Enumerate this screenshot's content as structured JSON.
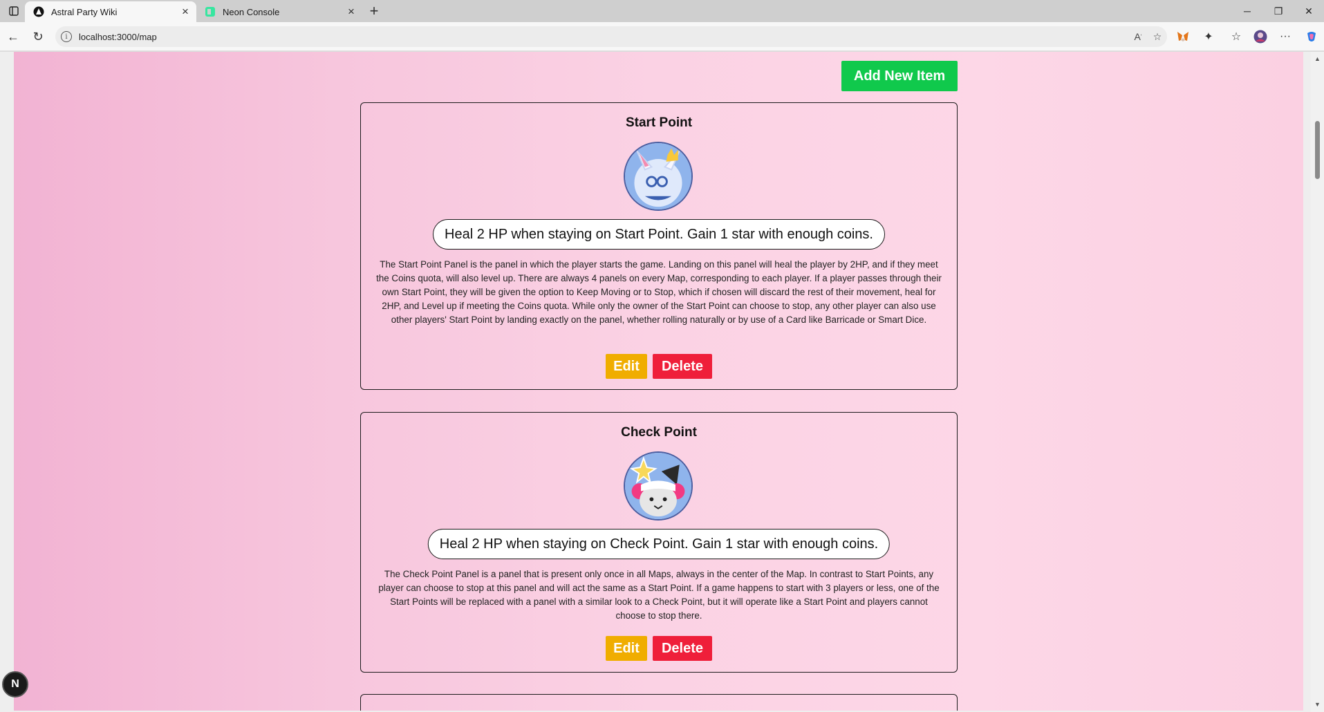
{
  "browser": {
    "tabs": [
      {
        "title": "Astral Party Wiki",
        "active": true,
        "icon": "app-logo-icon"
      },
      {
        "title": "Neon Console",
        "active": false,
        "icon": "neon-logo-icon"
      }
    ],
    "url": "localhost:3000/map"
  },
  "page": {
    "add_button_label": "Add New Item",
    "items": [
      {
        "name": "Start Point",
        "summary": "Heal 2 HP when staying on Start Point. Gain 1 star with enough coins.",
        "description": "The Start Point Panel is the panel in which the player starts the game. Landing on this panel will heal the player by 2HP, and if they meet the Coins quota, will also level up. There are always 4 panels on every Map, corresponding to each player. If a player passes through their own Start Point, they will be given the option to Keep Moving or to Stop, which if chosen will discard the rest of their movement, heal for 2HP, and Level up if meeting the Coins quota. While only the owner of the Start Point can choose to stop, any other player can also use other players' Start Point by landing exactly on the panel, whether rolling naturally or by use of a Card like Barricade or Smart Dice.",
        "edit_label": "Edit",
        "delete_label": "Delete"
      },
      {
        "name": "Check Point",
        "summary": "Heal 2 HP when staying on Check Point. Gain 1 star with enough coins.",
        "description": "The Check Point Panel is a panel that is present only once in all Maps, always in the center of the Map. In contrast to Start Points, any player can choose to stop at this panel and will act the same as a Start Point. If a game happens to start with 3 players or less, one of the Start Points will be replaced with a panel with a similar look to a Check Point, but it will operate like a Start Point and players cannot choose to stop there.",
        "edit_label": "Edit",
        "delete_label": "Delete"
      }
    ],
    "dev_badge": "N"
  },
  "colors": {
    "add_button": "#10c94c",
    "edit_button": "#f0ad00",
    "delete_button": "#ef1f3a",
    "page_background": "#fbd2e4"
  }
}
